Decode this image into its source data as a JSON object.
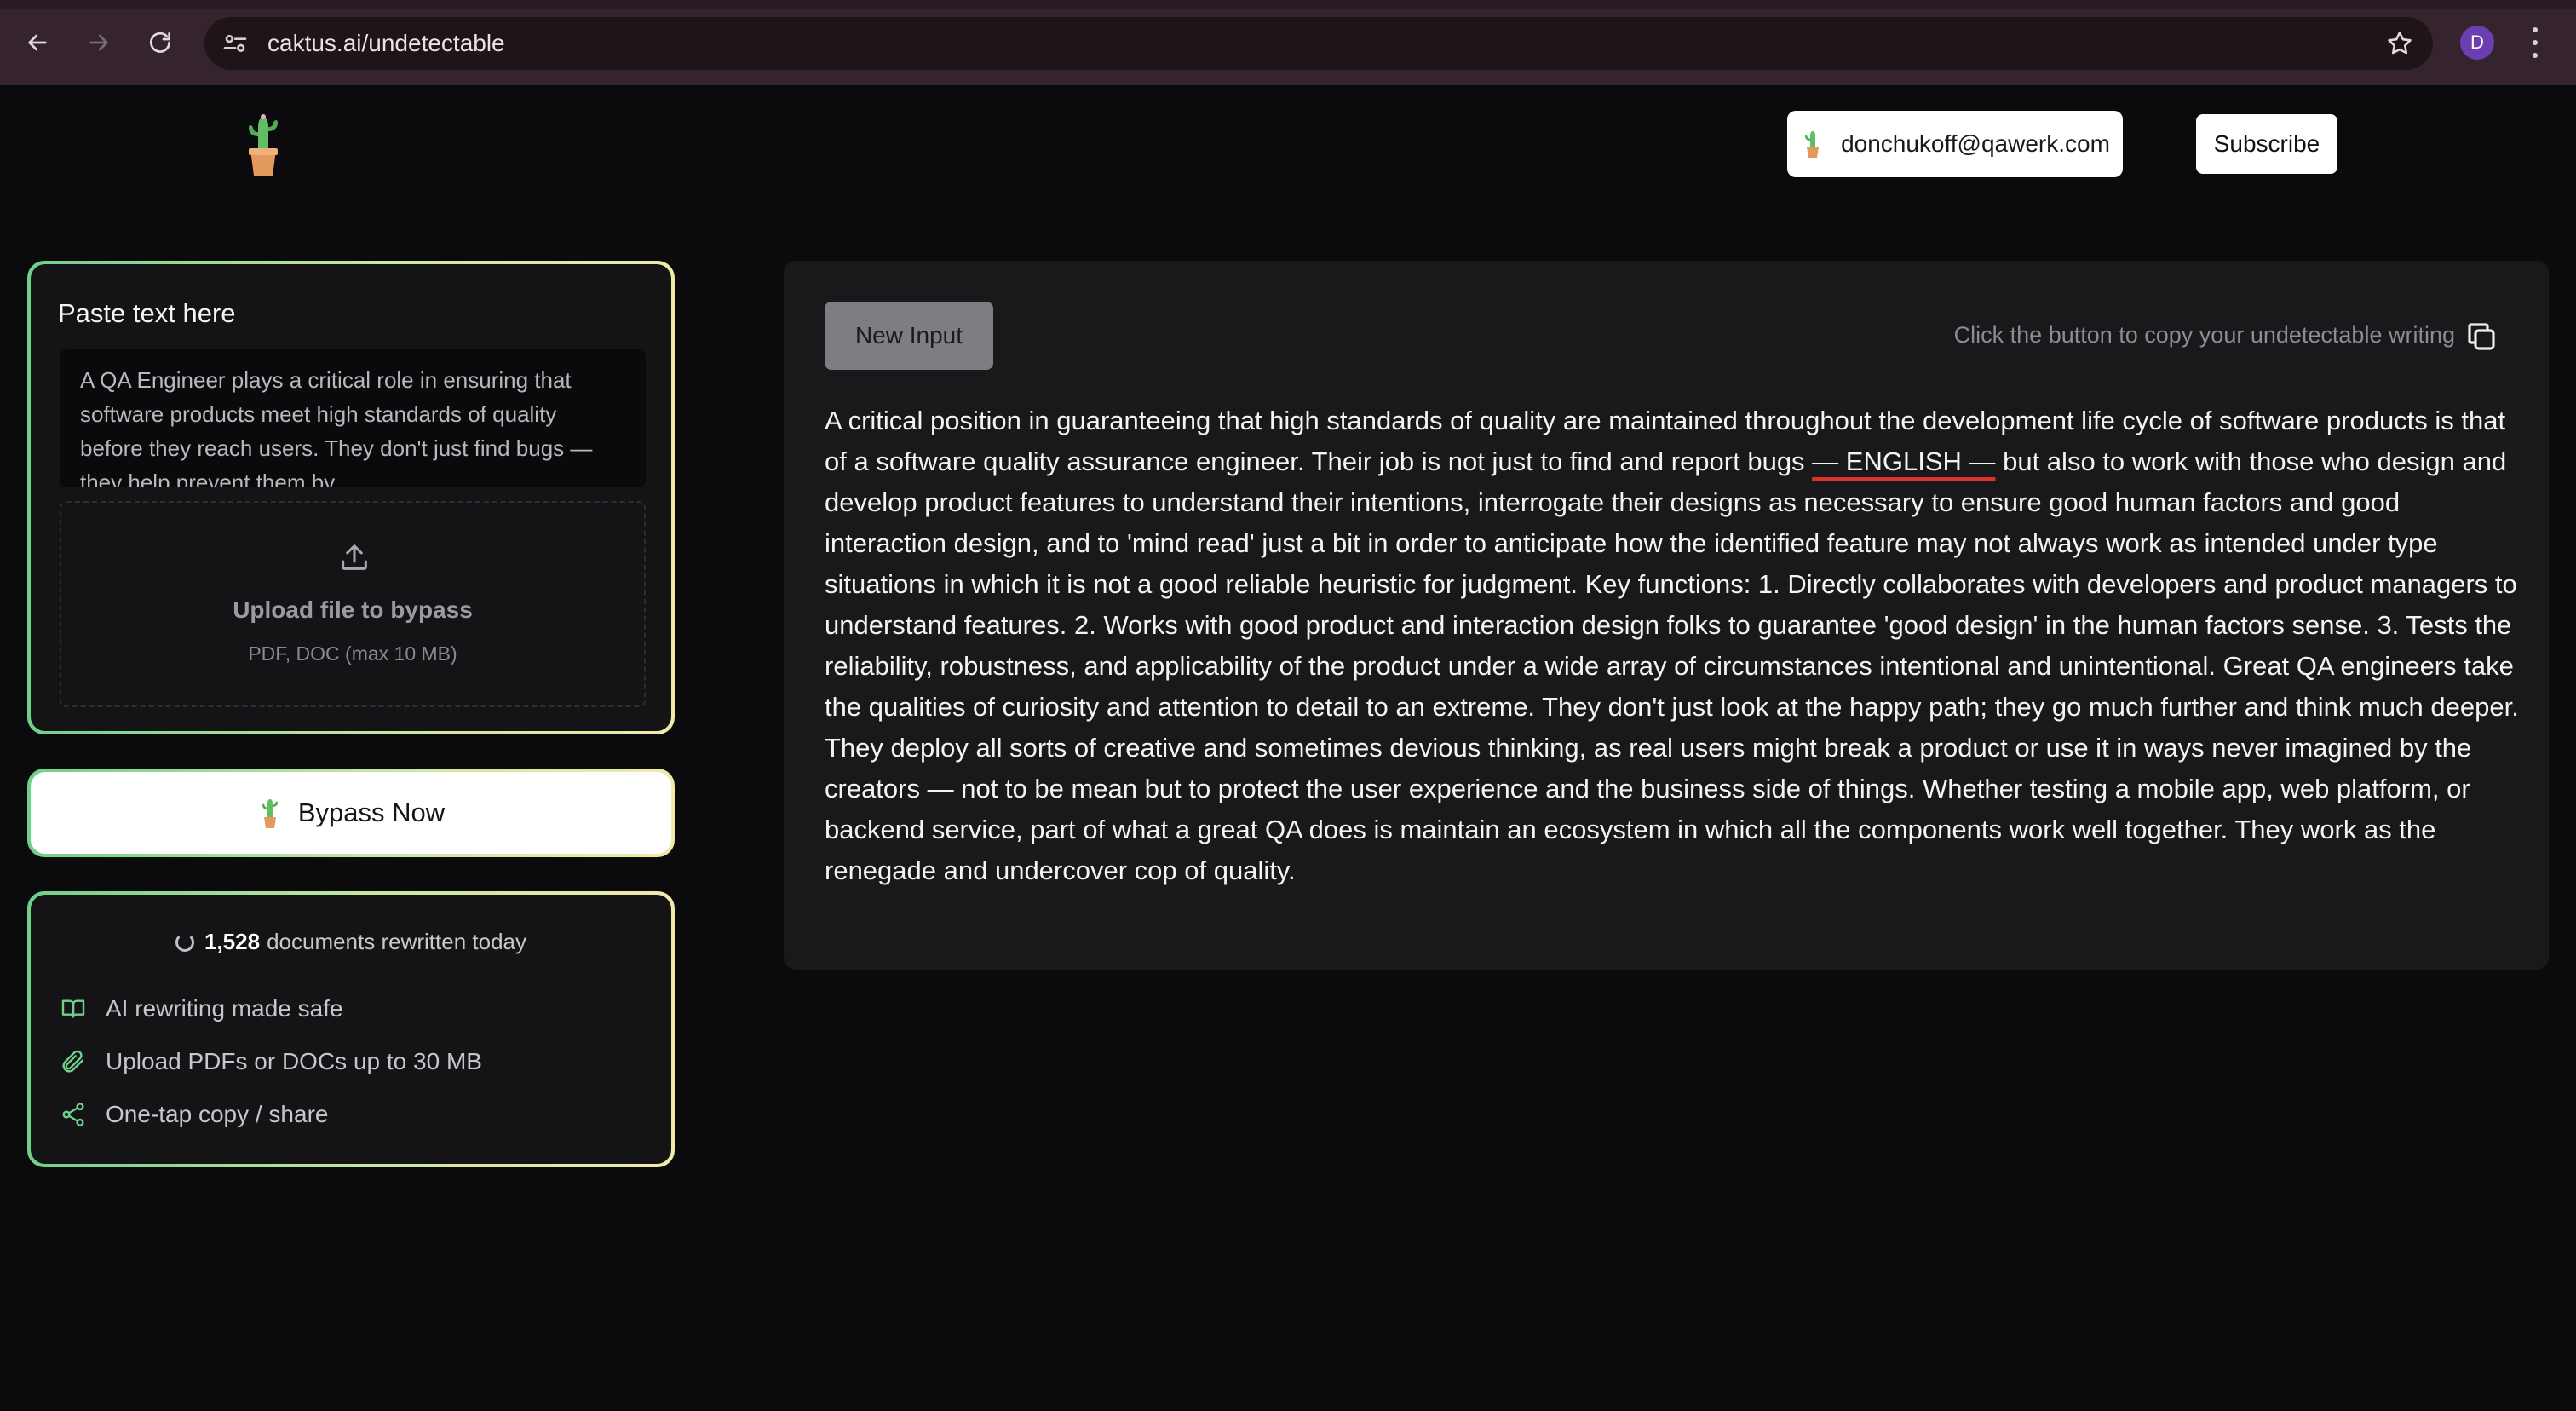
{
  "browser": {
    "url": "caktus.ai/undetectable",
    "profile_initial": "D"
  },
  "header": {
    "account_email": "donchukoff@qawerk.com",
    "subscribe_label": "Subscribe"
  },
  "input_card": {
    "title": "Paste text here",
    "text": "A QA Engineer plays a critical role in ensuring that software products meet high standards of quality before they reach users. They don't just find bugs — they help prevent them by",
    "upload_title": "Upload file to bypass",
    "upload_subtitle": "PDF, DOC (max 10 MB)"
  },
  "bypass_button": {
    "label": "Bypass Now"
  },
  "stats": {
    "count": "1,528",
    "count_suffix": "documents rewritten today",
    "features": [
      {
        "icon": "book-icon",
        "label": "AI rewriting made safe"
      },
      {
        "icon": "paperclip-icon",
        "label": "Upload PDFs or DOCs up to 30 MB"
      },
      {
        "icon": "share-icon",
        "label": "One-tap copy / share"
      }
    ]
  },
  "output": {
    "new_input_label": "New Input",
    "copy_hint": "Click the button to copy your undetectable writing",
    "text_before_flag": "A critical position in guaranteeing that high standards of quality are maintained throughout the development life cycle of software products is that of a software quality assurance engineer. Their job is not just to find and report bugs ",
    "flagged_text": "— ENGLISH —",
    "text_after_flag": " but also to work with those who design and develop product features to understand their intentions, interrogate their designs as necessary to ensure good human factors and good interaction design, and to 'mind read' just a bit in order to anticipate how the identified feature may not always work as intended under type situations in which it is not a good reliable heuristic for judgment. Key functions: 1. Directly collaborates with developers and product managers to understand features. 2. Works with good product and interaction design folks to guarantee 'good design' in the human factors sense. 3. Tests the reliability, robustness, and applicability of the product under a wide array of circumstances intentional and unintentional. Great QA engineers take the qualities of curiosity and attention to detail to an extreme. They don't just look at the happy path; they go much further and think much deeper. They deploy all sorts of creative and sometimes devious thinking, as real users might break a product or use it in ways never imagined by the creators — not to be mean but to protect the user experience and the business side of things. Whether testing a mobile app, web platform, or backend service, part of what a great QA does is maintain an ecosystem in which all the components work well together. They work as the renegade and undercover cop of quality."
  },
  "colors": {
    "accent_green": "#6fd08a",
    "accent_yellow": "#f1eba8",
    "flag_underline": "#e0322c"
  }
}
